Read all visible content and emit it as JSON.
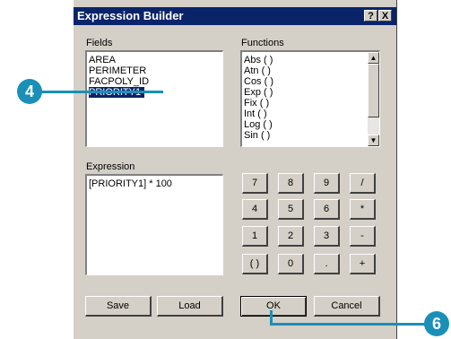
{
  "dialog": {
    "title": "Expression Builder",
    "help_btn": "?",
    "close_btn": "X"
  },
  "fields": {
    "label": "Fields",
    "items": [
      "AREA",
      "PERIMETER",
      "FACPOLY_ID",
      "PRIORITY1"
    ],
    "selected": "PRIORITY1"
  },
  "functions": {
    "label": "Functions",
    "items": [
      "Abs ( )",
      "Atn ( )",
      "Cos ( )",
      "Exp ( )",
      "Fix ( )",
      "Int ( )",
      "Log ( )",
      "Sin ( )"
    ]
  },
  "expression": {
    "label": "Expression",
    "value": "[PRIORITY1] * 100"
  },
  "keypad": {
    "row1": [
      "7",
      "8",
      "9",
      "/"
    ],
    "row2": [
      "4",
      "5",
      "6",
      "*"
    ],
    "row3": [
      "1",
      "2",
      "3",
      "-"
    ],
    "row4": [
      "( )",
      "0",
      ".",
      "+"
    ]
  },
  "buttons": {
    "save": "Save",
    "load": "Load",
    "ok": "OK",
    "cancel": "Cancel"
  },
  "callouts": {
    "step4": "4",
    "step6": "6"
  },
  "colors": {
    "titlebar": "#0a246a",
    "callout": "#1a8fb8"
  }
}
